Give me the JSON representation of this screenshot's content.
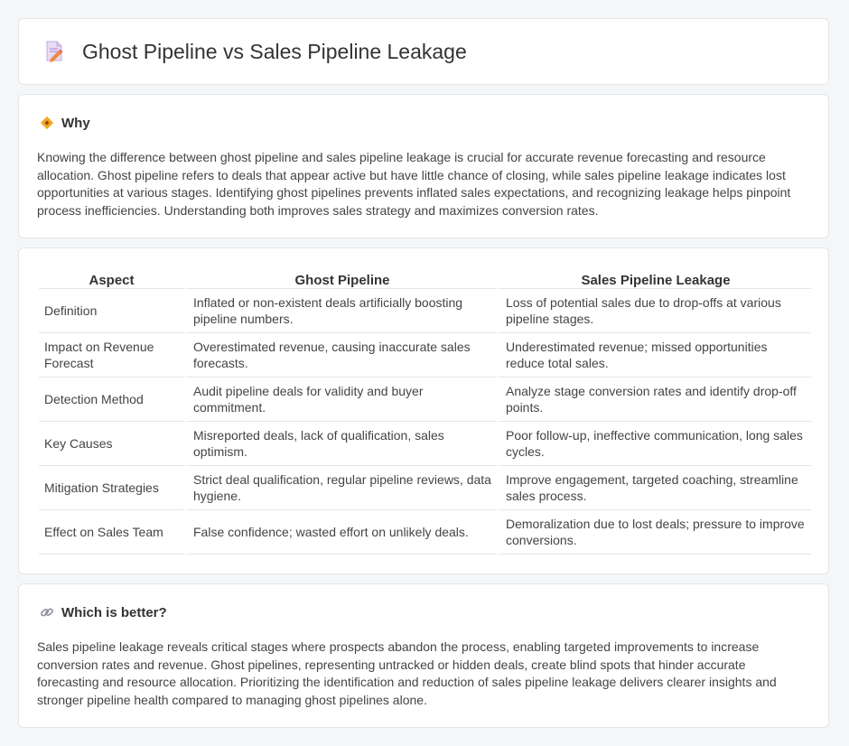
{
  "header": {
    "title": "Ghost Pipeline vs Sales Pipeline Leakage",
    "icon": "document-pen-icon"
  },
  "why": {
    "heading": "Why",
    "icon": "diamond-signal-icon",
    "text": "Knowing the difference between ghost pipeline and sales pipeline leakage is crucial for accurate revenue forecasting and resource allocation. Ghost pipeline refers to deals that appear active but have little chance of closing, while sales pipeline leakage indicates lost opportunities at various stages. Identifying ghost pipelines prevents inflated sales expectations, and recognizing leakage helps pinpoint process inefficiencies. Understanding both improves sales strategy and maximizes conversion rates."
  },
  "table": {
    "headers": [
      "Aspect",
      "Ghost Pipeline",
      "Sales Pipeline Leakage"
    ],
    "rows": [
      [
        "Definition",
        "Inflated or non-existent deals artificially boosting pipeline numbers.",
        "Loss of potential sales due to drop-offs at various pipeline stages."
      ],
      [
        "Impact on Revenue Forecast",
        "Overestimated revenue, causing inaccurate sales forecasts.",
        "Underestimated revenue; missed opportunities reduce total sales."
      ],
      [
        "Detection Method",
        "Audit pipeline deals for validity and buyer commitment.",
        "Analyze stage conversion rates and identify drop-off points."
      ],
      [
        "Key Causes",
        "Misreported deals, lack of qualification, sales optimism.",
        "Poor follow-up, ineffective communication, long sales cycles."
      ],
      [
        "Mitigation Strategies",
        "Strict deal qualification, regular pipeline reviews, data hygiene.",
        "Improve engagement, targeted coaching, streamline sales process."
      ],
      [
        "Effect on Sales Team",
        "False confidence; wasted effort on unlikely deals.",
        "Demoralization due to lost deals; pressure to improve conversions."
      ]
    ]
  },
  "better": {
    "heading": "Which is better?",
    "icon": "link-icon",
    "text": "Sales pipeline leakage reveals critical stages where prospects abandon the process, enabling targeted improvements to increase conversion rates and revenue. Ghost pipelines, representing untracked or hidden deals, create blind spots that hinder accurate forecasting and resource allocation. Prioritizing the identification and reduction of sales pipeline leakage delivers clearer insights and stronger pipeline health compared to managing ghost pipelines alone."
  }
}
